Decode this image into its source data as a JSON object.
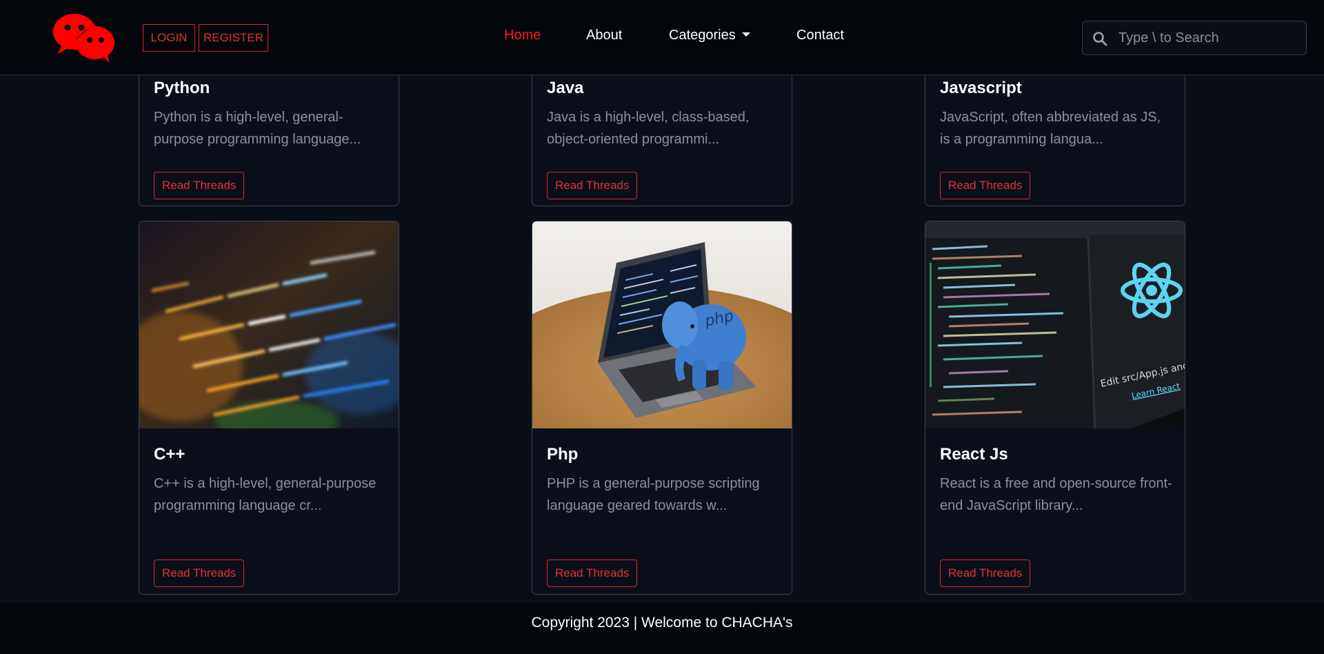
{
  "header": {
    "auth": {
      "login_label": "LOGIN",
      "register_label": "REGISTER"
    },
    "nav": [
      {
        "label": "Home",
        "active": true
      },
      {
        "label": "About"
      },
      {
        "label": "Categories",
        "has_dropdown": true
      },
      {
        "label": "Contact"
      }
    ],
    "search": {
      "placeholder": "Type \\ to Search",
      "icon": "search-icon"
    }
  },
  "colors": {
    "accent": "#ff1a1a",
    "button_border": "#d62828",
    "background": "#0a0e17"
  },
  "cards": [
    {
      "title": "Python",
      "text": "Python is a high-level, general-purpose programming language...",
      "button": "Read Threads"
    },
    {
      "title": "Java",
      "text": "Java is a high-level, class-based, object-oriented programmi...",
      "button": "Read Threads"
    },
    {
      "title": "Javascript",
      "text": "JavaScript, often abbreviated as JS, is a programming langua...",
      "button": "Read Threads"
    },
    {
      "title": "C++",
      "text": "C++ is a high-level, general-purpose programming language cr...",
      "button": "Read Threads",
      "image": "code-screen-photo"
    },
    {
      "title": "Php",
      "text": "PHP is a general-purpose scripting language geared towards w...",
      "button": "Read Threads",
      "image": "laptop-php-elephant-photo",
      "image_label": "php"
    },
    {
      "title": "React Js",
      "text": "React is a free and open-source front-end JavaScript library...",
      "button": "Read Threads",
      "image": "react-code-screen-photo",
      "image_labels": [
        "Edit src/App.js and save to reload.",
        "Learn React"
      ]
    }
  ],
  "footer": {
    "text": "Copyright 2023 | Welcome to CHACHA's"
  }
}
